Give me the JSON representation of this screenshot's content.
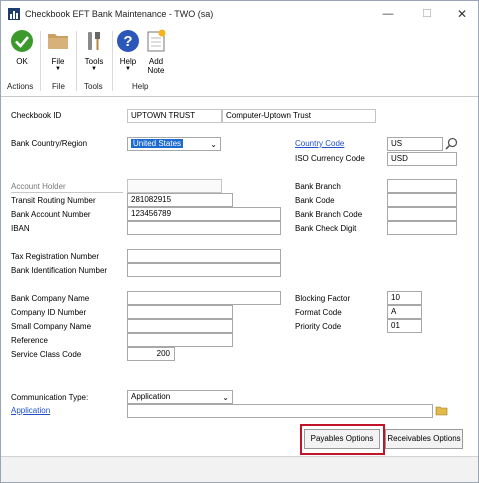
{
  "window": {
    "title": "Checkbook EFT Bank Maintenance  -  TWO (sa)",
    "minimize_glyph": "—",
    "maximize_glyph": "☐",
    "close_glyph": "✕"
  },
  "ribbon": {
    "buttons": [
      {
        "label": "OK",
        "icon": "checkmark-icon"
      },
      {
        "label": "File",
        "icon": "folder-icon",
        "has_menu": true
      },
      {
        "label": "Tools",
        "icon": "tools-icon",
        "has_menu": true
      },
      {
        "label": "Help",
        "icon": "help-icon",
        "has_menu": true
      },
      {
        "label": "Add",
        "label2": "Note",
        "icon": "note-icon"
      }
    ],
    "caret": "▼",
    "groups": [
      "Actions",
      "File",
      "Tools",
      "Help"
    ]
  },
  "form": {
    "checkbook_id": {
      "label": "Checkbook ID",
      "value": "UPTOWN TRUST",
      "description": "Computer-Uptown Trust"
    },
    "bank_country": {
      "label": "Bank Country/Region",
      "value": "United States"
    },
    "country_code": {
      "label": "Country Code",
      "value": "US"
    },
    "iso_currency": {
      "label": "ISO Currency Code",
      "value": "USD"
    },
    "account_holder": {
      "label": "Account Holder",
      "value": ""
    },
    "transit_routing": {
      "label": "Transit Routing Number",
      "value": "281082915"
    },
    "bank_account": {
      "label": "Bank Account Number",
      "value": "123456789"
    },
    "iban": {
      "label": "IBAN",
      "value": ""
    },
    "bank_branch": {
      "label": "Bank Branch",
      "value": ""
    },
    "bank_code": {
      "label": "Bank Code",
      "value": ""
    },
    "bank_branch_code": {
      "label": "Bank Branch Code",
      "value": ""
    },
    "bank_check_digit": {
      "label": "Bank Check Digit",
      "value": ""
    },
    "tax_registration": {
      "label": "Tax Registration Number",
      "value": ""
    },
    "bank_identification": {
      "label": "Bank Identification Number",
      "value": ""
    },
    "bank_company_name": {
      "label": "Bank Company Name",
      "value": ""
    },
    "company_id": {
      "label": "Company ID Number",
      "value": ""
    },
    "small_company_name": {
      "label": "Small Company Name",
      "value": ""
    },
    "reference": {
      "label": "Reference",
      "value": ""
    },
    "service_class_code": {
      "label": "Service Class Code",
      "value": "200"
    },
    "blocking_factor": {
      "label": "Blocking Factor",
      "value": "10"
    },
    "format_code": {
      "label": "Format Code",
      "value": "A"
    },
    "priority_code": {
      "label": "Priority Code",
      "value": "01"
    },
    "communication_type": {
      "label": "Communication Type:",
      "value": "Application"
    },
    "application": {
      "label": "Application",
      "value": ""
    }
  },
  "buttons": {
    "payables": "Payables Options",
    "receivables": "Receivables Options"
  },
  "colors": {
    "highlight": "#c0142a",
    "link": "#1f4fc8",
    "selection": "#1d6ad1"
  }
}
